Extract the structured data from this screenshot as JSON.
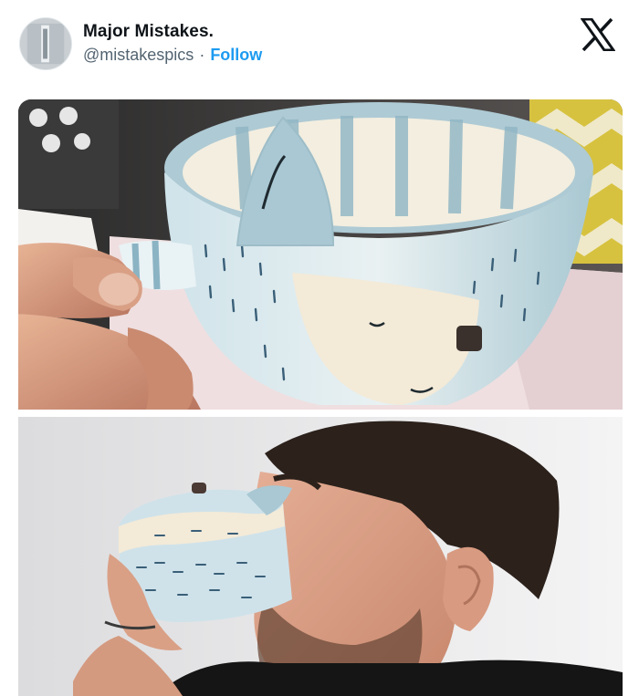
{
  "tweet": {
    "author_name": "Major Mistakes.",
    "handle": "@mistakespics",
    "separator": "·",
    "follow_label": "Follow",
    "platform_icon": "x-logo-icon",
    "avatar_icon": "avatar"
  },
  "media": [
    {
      "kind": "photo",
      "subject": "ceramic cat mug with handle held in hand"
    },
    {
      "kind": "photo",
      "subject": "man drinking from mug with cat ear poking his eye"
    }
  ],
  "colors": {
    "name_text": "#0f1419",
    "handle_text": "#536471",
    "follow_accent": "#1d9bf0",
    "background": "#ffffff"
  }
}
